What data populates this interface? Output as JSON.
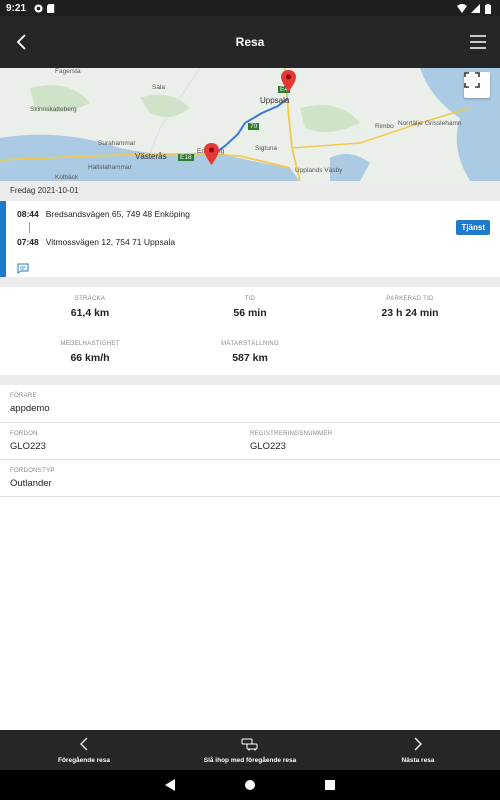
{
  "status_bar": {
    "time": "9:21"
  },
  "app_bar": {
    "title": "Resa"
  },
  "map": {
    "labels": [
      "Fagersta",
      "Sala",
      "Skinnskatteberg",
      "Surahammar",
      "Hallstahammar",
      "Kolbäck",
      "Västerås",
      "Uppsala",
      "Norrtälje",
      "Rimbo",
      "Grisslehamn",
      "Upplands Väsby",
      "Enköping",
      "E18",
      "E4",
      "70",
      "Sigtuna"
    ]
  },
  "trip": {
    "date": "Fredag 2021-10-01",
    "start_time": "08:44",
    "start_address": "Bredsandsvägen 65, 749 48 Enköping",
    "end_time": "07:48",
    "end_address": "Vitmossvägen 12, 754 71 Uppsala",
    "badge": "Tjänst"
  },
  "stats": {
    "distance_label": "STRÄCKA",
    "distance_value": "61,4 km",
    "time_label": "TID",
    "time_value": "56 min",
    "parked_label": "PARKERAD TID",
    "parked_value": "23 h  24 min",
    "avg_speed_label": "MEDELHASTIGHET",
    "avg_speed_value": "66 km/h",
    "odometer_label": "MÄTARSTÄLLNING",
    "odometer_value": "587 km"
  },
  "details": {
    "driver_label": "FÖRARE",
    "driver_value": "appdemo",
    "vehicle_label": "FORDON",
    "vehicle_value": "GLO223",
    "reg_label": "REGISTRERINGSNUMMER",
    "reg_value": "GLO223",
    "vehicle_type_label": "FORDONSTYP",
    "vehicle_type_value": "Outlander"
  },
  "bottom_bar": {
    "prev_label": "Föregående resa",
    "merge_label": "Slå ihop med föregående resa",
    "next_label": "Nästa resa"
  },
  "colors": {
    "accent": "#1f7ac9",
    "bar_bg": "#262626",
    "pin": "#e53935"
  }
}
